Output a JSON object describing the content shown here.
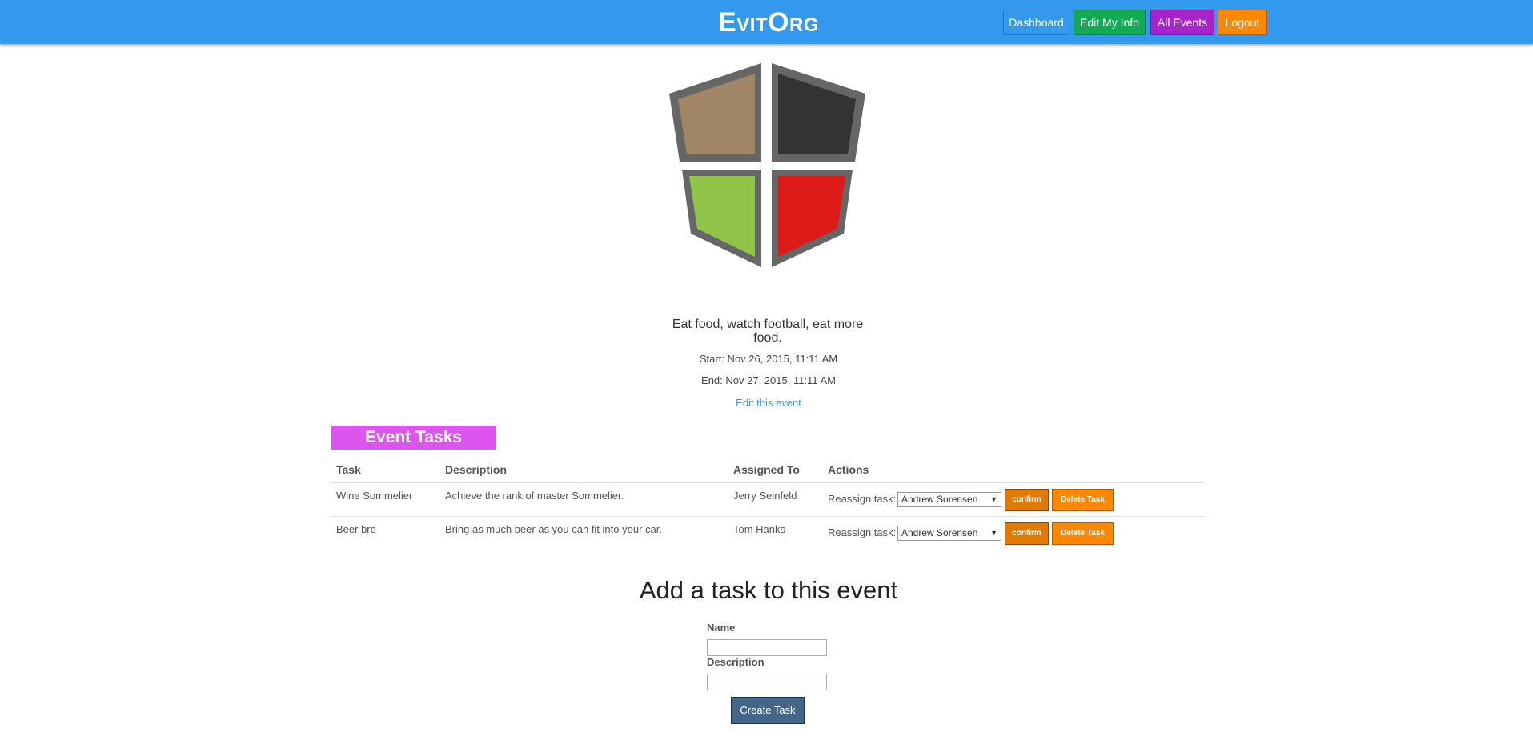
{
  "header": {
    "brand": "EvitOrg",
    "nav": [
      {
        "label": "Dashboard",
        "color": "#3399ee"
      },
      {
        "label": "Edit My Info",
        "color": "#11aa55"
      },
      {
        "label": "All Events",
        "color": "#aa22cc"
      },
      {
        "label": "Logout",
        "color": "#ff8800"
      }
    ]
  },
  "logo": {
    "colors": {
      "frame": "#666666",
      "top_left": "#a08566",
      "top_right": "#333333",
      "bottom_left": "#92c44a",
      "bottom_right": "#dd1c1a"
    }
  },
  "event": {
    "description": "Eat food, watch football, eat more food.",
    "start": "Start: Nov 26, 2015, 11:11 AM",
    "end": "End: Nov 27, 2015, 11:11 AM",
    "edit_link": "Edit this event"
  },
  "tasks": {
    "section_title": "Event Tasks",
    "columns": [
      "Task",
      "Description",
      "Assigned To",
      "Actions"
    ],
    "rows": [
      {
        "task": "Wine Sommelier",
        "description": "Achieve the rank of master Sommelier.",
        "assigned_to": "Jerry Seinfeld",
        "reassign_label": "Reassign task:",
        "reassign_value": "Andrew Sorensen",
        "confirm": "confirm",
        "delete": "Delete Task"
      },
      {
        "task": "Beer bro",
        "description": "Bring as much beer as you can fit into your car.",
        "assigned_to": "Tom Hanks",
        "reassign_label": "Reassign task:",
        "reassign_value": "Andrew Sorensen",
        "confirm": "confirm",
        "delete": "Delete Task"
      }
    ]
  },
  "add_task": {
    "title": "Add a task to this event",
    "name_label": "Name",
    "description_label": "Description",
    "name_value": "",
    "description_value": "",
    "submit": "Create Task"
  }
}
